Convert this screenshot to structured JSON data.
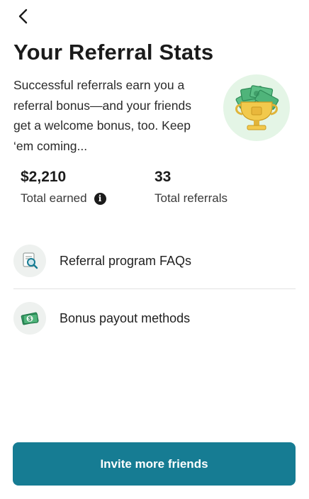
{
  "header": {
    "back_icon": "chevron-left-icon",
    "title": "Your Referral Stats"
  },
  "intro": {
    "description": "Successful referrals earn you a referral bonus—and your friends get a welcome bonus, too. Keep ‘em coming...",
    "illustration": "trophy-with-cash-icon"
  },
  "stats": {
    "earned": {
      "value": "$2,210",
      "label": "Total earned",
      "icon": "info-icon"
    },
    "referrals": {
      "value": "33",
      "label": "Total referrals"
    }
  },
  "links": [
    {
      "label": "Referral program FAQs",
      "icon": "document-search-icon"
    },
    {
      "label": "Bonus payout methods",
      "icon": "cash-icon"
    }
  ],
  "cta": {
    "label": "Invite more friends"
  },
  "colors": {
    "accent": "#167c93",
    "icon_bg": "#eef1ef",
    "trophy_bg": "#e4f5e6",
    "gold": "#f2c94c",
    "money_green": "#3aa76d"
  }
}
